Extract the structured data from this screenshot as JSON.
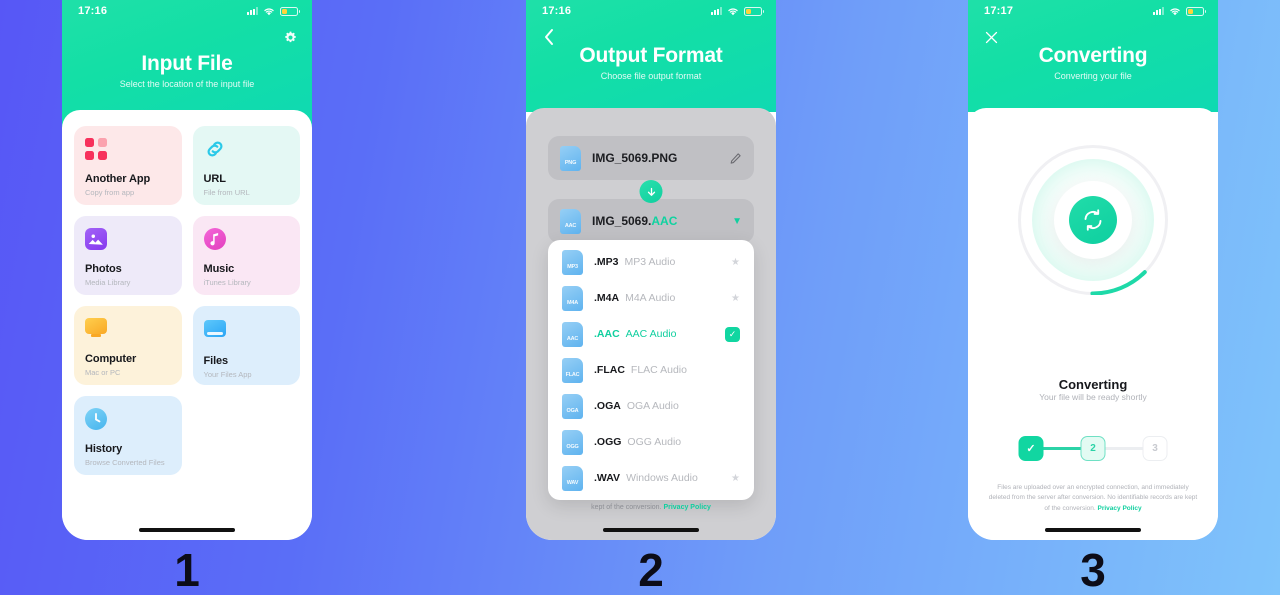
{
  "background": {
    "from": "#5757f6",
    "to": "#7fc4fb"
  },
  "accent": "#10cf9f",
  "screens": [
    {
      "index": "1",
      "status": {
        "time": "17:16"
      },
      "header": {
        "title": "Input File",
        "subtitle": "Select the location of the input file",
        "action_icon": "gear-icon"
      },
      "cards": [
        {
          "title": "Another App",
          "subtitle": "Copy from app",
          "icon": "grid-dots-icon"
        },
        {
          "title": "URL",
          "subtitle": "File from URL",
          "icon": "link-icon"
        },
        {
          "title": "Photos",
          "subtitle": "Media Library",
          "icon": "photos-icon"
        },
        {
          "title": "Music",
          "subtitle": "iTunes Library",
          "icon": "music-note-icon"
        },
        {
          "title": "Computer",
          "subtitle": "Mac or PC",
          "icon": "monitor-icon"
        },
        {
          "title": "Files",
          "subtitle": "Your Files App",
          "icon": "folder-icon"
        },
        {
          "title": "History",
          "subtitle": "Browse Converted Files",
          "icon": "clock-icon"
        }
      ]
    },
    {
      "index": "2",
      "status": {
        "time": "17:16"
      },
      "header": {
        "title": "Output Format",
        "subtitle": "Choose file output format",
        "action_icon": "back-chevron-icon"
      },
      "input_row": {
        "badge": "PNG",
        "filename": "IMG_5069.PNG",
        "action_icon": "pencil-icon"
      },
      "output_row": {
        "badge": "AAC",
        "name": "IMG_5069.",
        "extension": "AAC",
        "action_icon": "caret-down-icon"
      },
      "transfer_icon": "arrow-down-circle-icon",
      "formats": [
        {
          "ext": ".MP3",
          "desc": "MP3 Audio",
          "badge": "MP3",
          "selected": false,
          "starred": true
        },
        {
          "ext": ".M4A",
          "desc": "M4A Audio",
          "badge": "M4A",
          "selected": false,
          "starred": true
        },
        {
          "ext": ".AAC",
          "desc": "AAC Audio",
          "badge": "AAC",
          "selected": true,
          "starred": false
        },
        {
          "ext": ".FLAC",
          "desc": "FLAC Audio",
          "badge": "FLAC",
          "selected": false,
          "starred": false
        },
        {
          "ext": ".OGA",
          "desc": "OGA Audio",
          "badge": "OGA",
          "selected": false,
          "starred": false
        },
        {
          "ext": ".OGG",
          "desc": "OGG Audio",
          "badge": "OGG",
          "selected": false,
          "starred": false
        },
        {
          "ext": ".WAV",
          "desc": "Windows Audio",
          "badge": "WAV",
          "selected": false,
          "starred": true
        }
      ],
      "privacy": {
        "text": "kept of the conversion.",
        "link": "Privacy Policy"
      }
    },
    {
      "index": "3",
      "status": {
        "time": "17:17"
      },
      "header": {
        "title": "Converting",
        "subtitle": "Converting your file",
        "action_icon": "close-icon"
      },
      "spinner": {
        "icon": "refresh-cycle-icon",
        "progress_percent": 12
      },
      "body": {
        "title": "Converting",
        "subtitle": "Your file will be ready shortly"
      },
      "steps": [
        {
          "label": "✓",
          "state": "done"
        },
        {
          "label": "2",
          "state": "current"
        },
        {
          "label": "3",
          "state": "todo"
        }
      ],
      "disclaimer": {
        "text": "Files are uploaded over an encrypted connection, and immediately deleted from the server after conversion. No identifiable records are kept of the conversion.",
        "link": "Privacy Policy"
      }
    }
  ]
}
